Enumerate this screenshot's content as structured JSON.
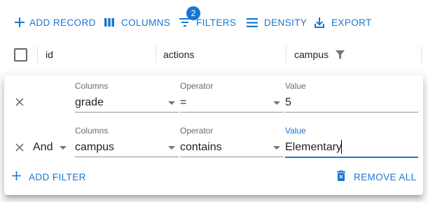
{
  "toolbar": {
    "add_record": "Add record",
    "columns": "Columns",
    "filters": "Filters",
    "filters_count": "2",
    "density": "Density",
    "export": "Export"
  },
  "header": {
    "columns": [
      "id",
      "actions",
      "campus"
    ]
  },
  "filter_panel": {
    "labels": {
      "columns": "Columns",
      "operator": "Operator",
      "value": "Value"
    },
    "filters": [
      {
        "logic": "",
        "column": "grade",
        "operator": "=",
        "value": "5"
      },
      {
        "logic": "And",
        "column": "campus",
        "operator": "contains",
        "value": "Elementary"
      }
    ],
    "add_filter": "Add filter",
    "remove_all": "Remove all"
  },
  "colors": {
    "accent": "#1976d2"
  },
  "icons": [
    "add-icon",
    "view-column-icon",
    "filter-list-icon",
    "density-icon",
    "export-icon",
    "filter-funnel-icon",
    "close-icon",
    "delete-icon",
    "chevron-down-icon"
  ]
}
